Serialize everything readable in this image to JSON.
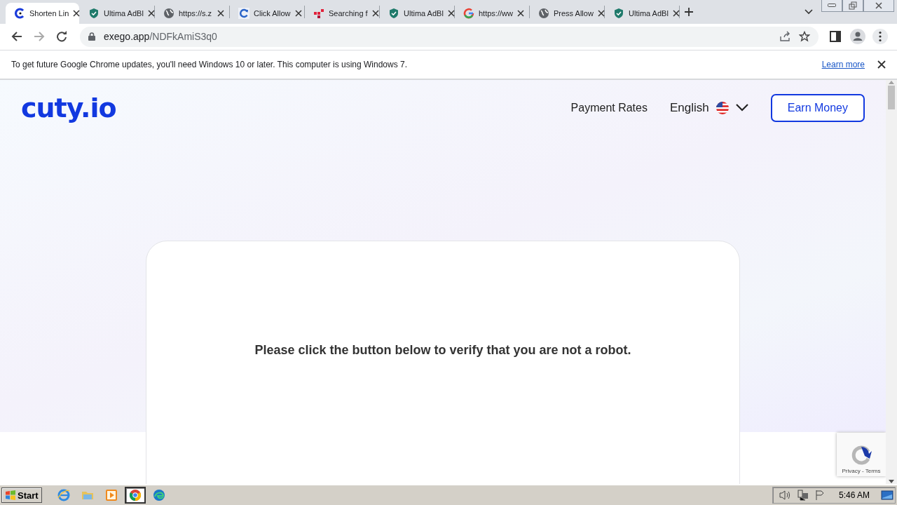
{
  "tabs": [
    {
      "kind": "cuty",
      "title": "Shorten Lin",
      "selected": true
    },
    {
      "kind": "shield",
      "title": "Ultima AdBl",
      "selected": false
    },
    {
      "kind": "globe",
      "title": "https://s.z",
      "selected": false
    },
    {
      "kind": "refresh",
      "title": "Click Allow",
      "selected": false
    },
    {
      "kind": "grid",
      "title": "Searching f",
      "selected": false
    },
    {
      "kind": "shield",
      "title": "Ultima AdBl",
      "selected": false
    },
    {
      "kind": "google",
      "title": "https://ww",
      "selected": false
    },
    {
      "kind": "globe",
      "title": "Press Allow",
      "selected": false
    },
    {
      "kind": "shield",
      "title": "Ultima AdBl",
      "selected": false
    }
  ],
  "address": {
    "host": "exego.app",
    "path": "/NDFkAmiS3q0"
  },
  "infobar": {
    "message": "To get future Google Chrome updates, you'll need Windows 10 or later. This computer is using Windows 7.",
    "link": "Learn more"
  },
  "site": {
    "logo": "cuty.io",
    "nav": [
      "Payment Rates"
    ],
    "language": "English",
    "cta": "Earn Money",
    "message": "Please click the button below to verify that you are not a robot.",
    "recaptcha": "Privacy - Terms"
  },
  "taskbar": {
    "start": "Start",
    "apps": [
      {
        "kind": "ie",
        "selected": false
      },
      {
        "kind": "folder",
        "selected": false
      },
      {
        "kind": "media",
        "selected": false
      },
      {
        "kind": "chrome",
        "selected": true
      },
      {
        "kind": "edge",
        "selected": false
      }
    ],
    "clock": "5:46 AM"
  }
}
